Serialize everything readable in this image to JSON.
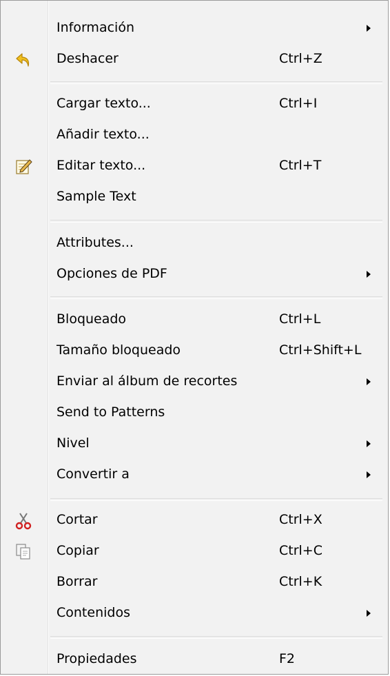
{
  "menu": {
    "items": [
      {
        "label": "Información",
        "shortcut": "",
        "submenu": true
      },
      {
        "label": "Deshacer",
        "shortcut": "Ctrl+Z",
        "icon": "undo-icon"
      },
      {
        "label": "Cargar texto...",
        "shortcut": "Ctrl+I"
      },
      {
        "label": "Añadir texto...",
        "shortcut": ""
      },
      {
        "label": "Editar texto...",
        "shortcut": "Ctrl+T",
        "icon": "edit-text-icon"
      },
      {
        "label": "Sample Text",
        "shortcut": ""
      },
      {
        "label": "Attributes...",
        "shortcut": ""
      },
      {
        "label": "Opciones de PDF",
        "shortcut": "",
        "submenu": true
      },
      {
        "label": "Bloqueado",
        "shortcut": "Ctrl+L"
      },
      {
        "label": "Tamaño bloqueado",
        "shortcut": "Ctrl+Shift+L"
      },
      {
        "label": "Enviar al álbum de recortes",
        "shortcut": "",
        "submenu": true
      },
      {
        "label": "Send to Patterns",
        "shortcut": ""
      },
      {
        "label": "Nivel",
        "shortcut": "",
        "submenu": true
      },
      {
        "label": "Convertir a",
        "shortcut": "",
        "submenu": true
      },
      {
        "label": "Cortar",
        "shortcut": "Ctrl+X",
        "icon": "cut-icon"
      },
      {
        "label": "Copiar",
        "shortcut": "Ctrl+C",
        "icon": "copy-icon"
      },
      {
        "label": "Borrar",
        "shortcut": "Ctrl+K"
      },
      {
        "label": "Contenidos",
        "shortcut": "",
        "submenu": true
      },
      {
        "label": "Propiedades",
        "shortcut": "F2"
      }
    ]
  }
}
